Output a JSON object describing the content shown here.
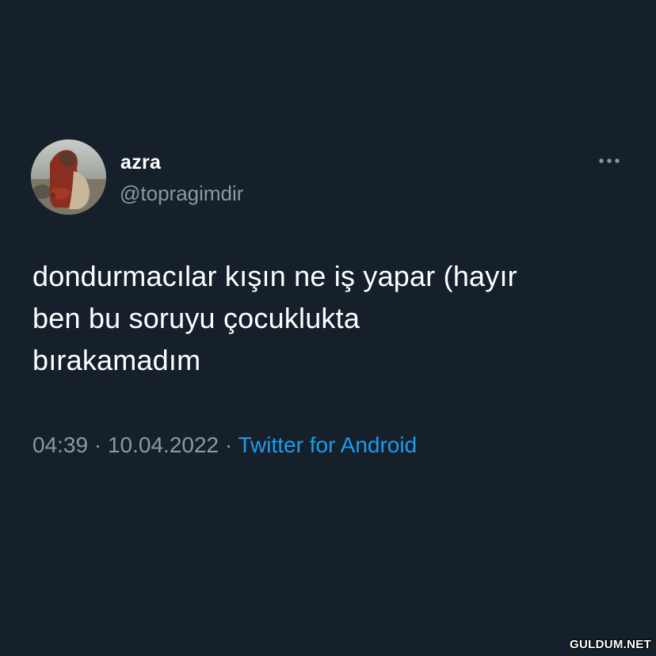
{
  "tweet": {
    "author": {
      "display_name": "azra",
      "handle": "@topragimdir"
    },
    "more_icon": "more-horizontal-icon",
    "text": "dondurmacılar kışın ne iş yapar (hayır\nben bu soruyu çocuklukta\nbırakamadım",
    "time": "04:39",
    "separator": "·",
    "date": "10.04.2022",
    "source": "Twitter for Android"
  },
  "watermark": "GULDUM.NET",
  "colors": {
    "background": "#15202b",
    "primary_text": "#ffffff",
    "secondary_text": "#8b98a5",
    "accent": "#1d9bf0"
  }
}
